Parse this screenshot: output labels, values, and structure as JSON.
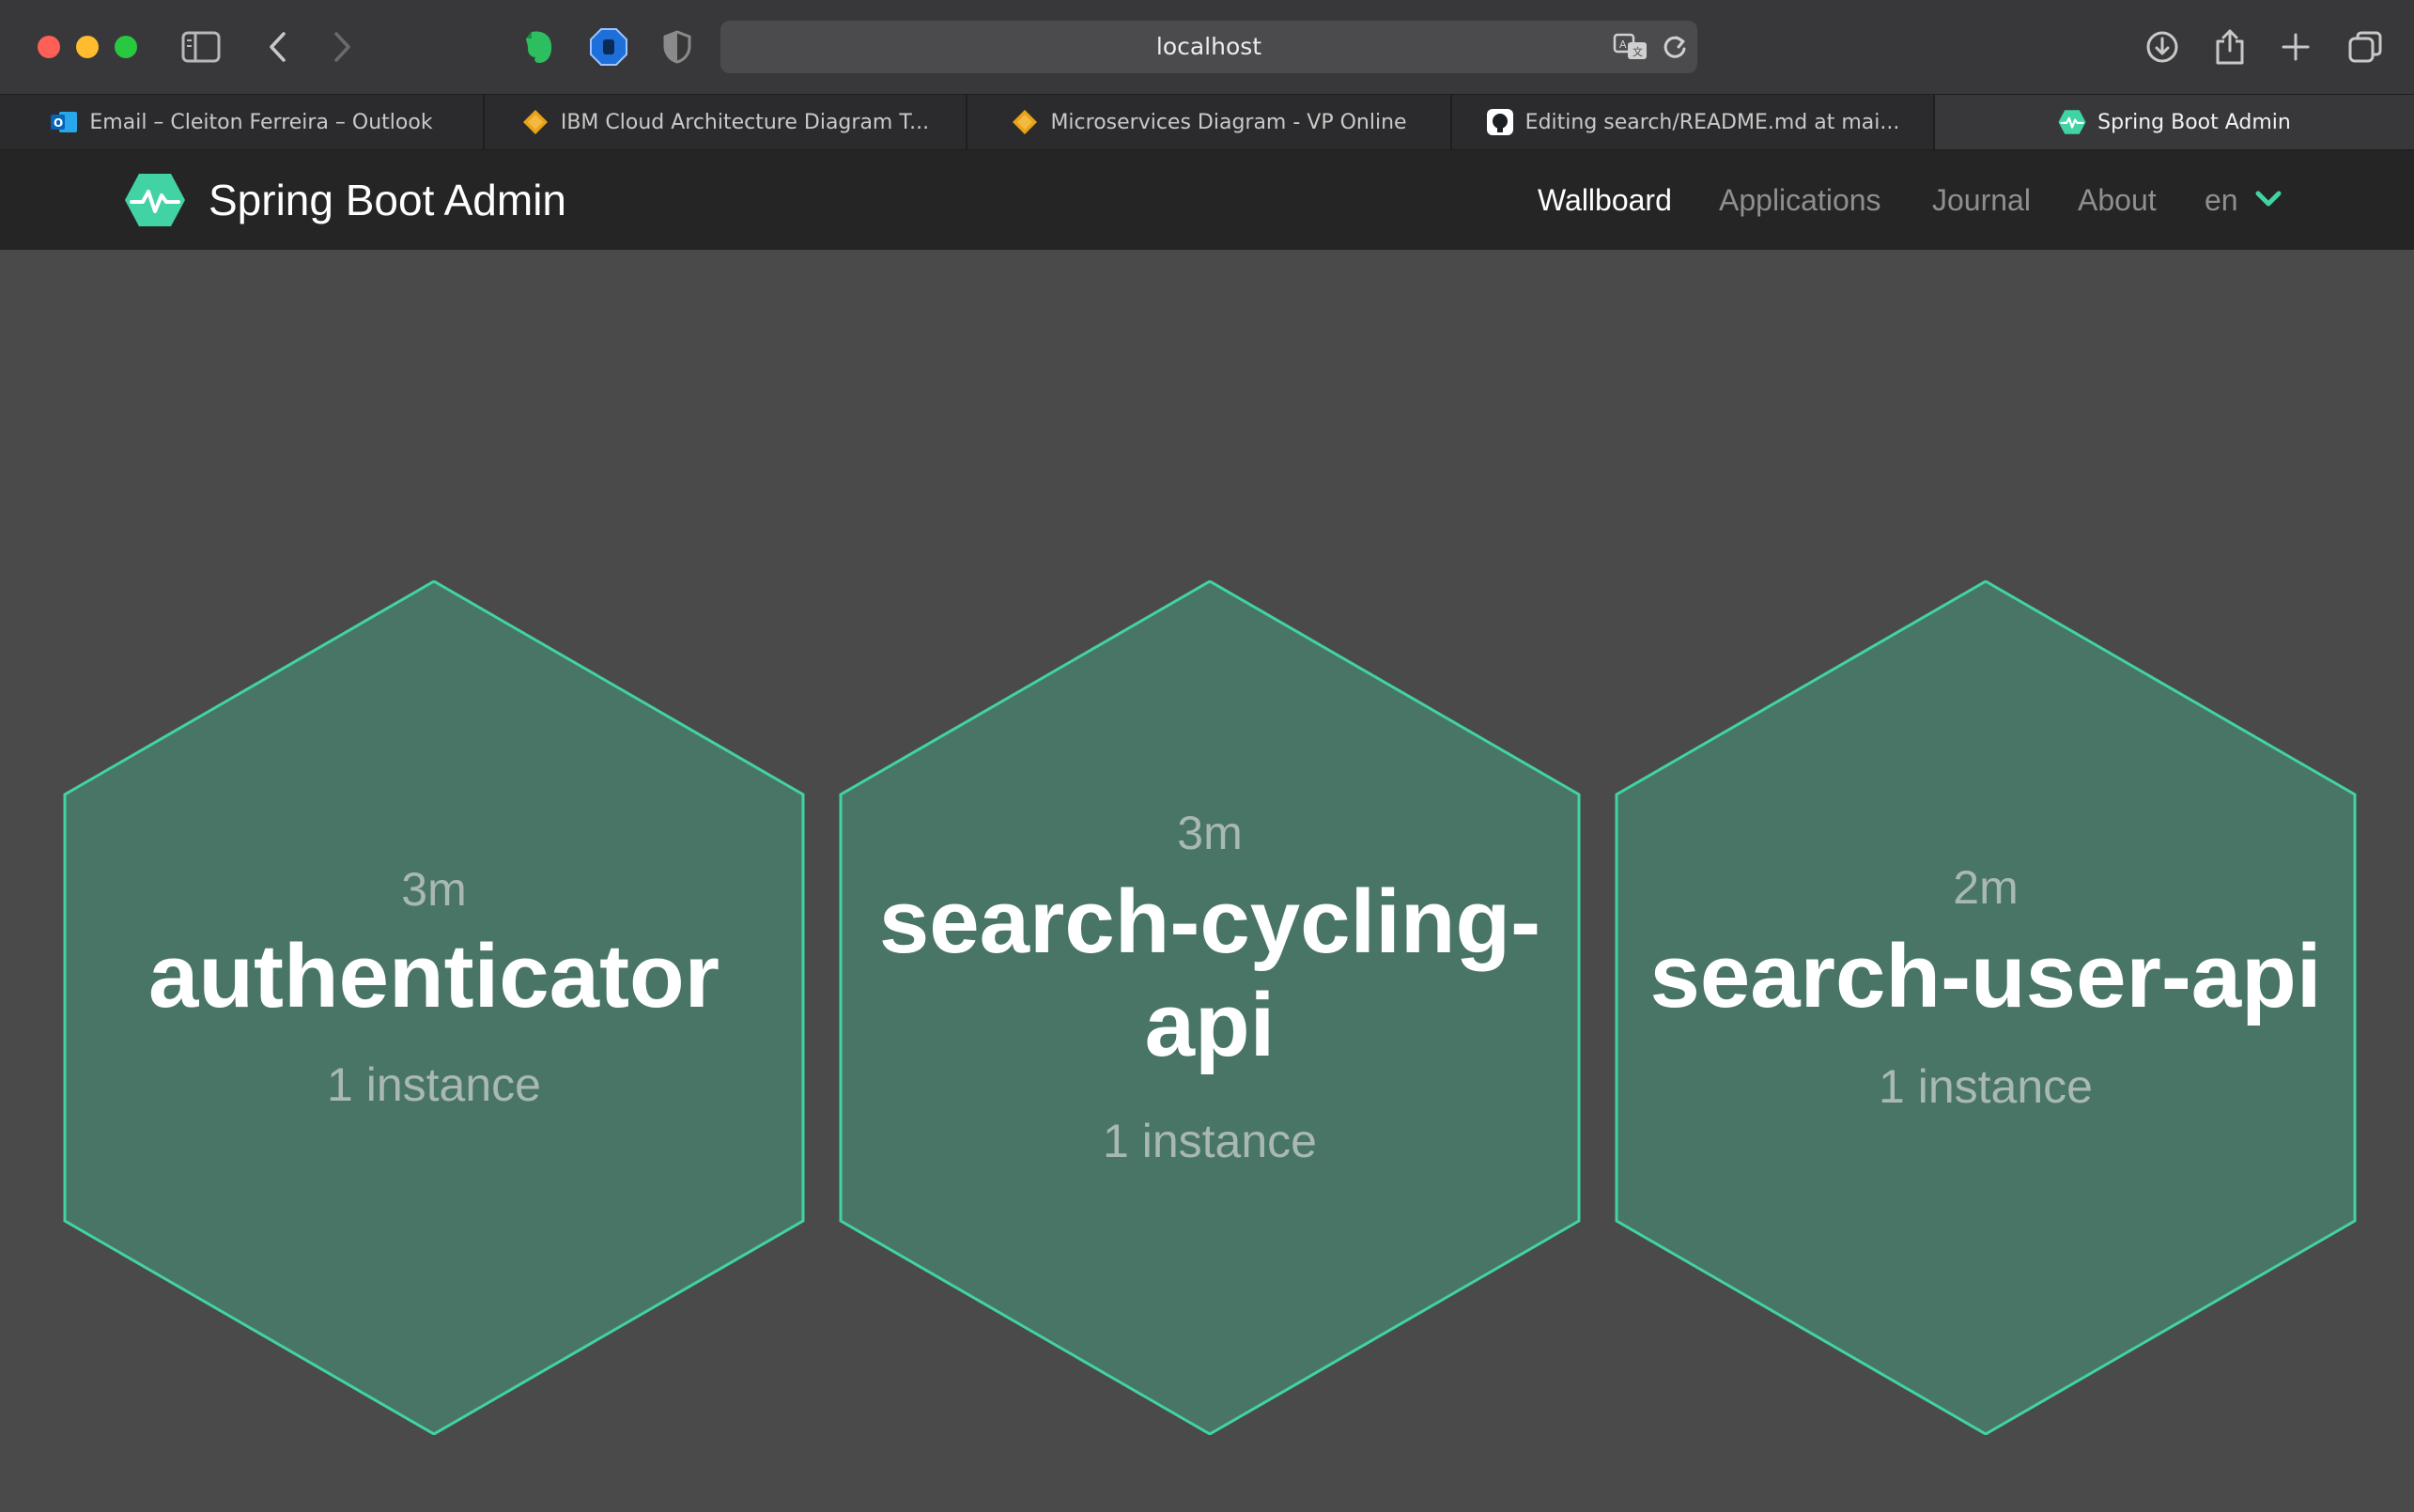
{
  "browser": {
    "url": "localhost",
    "tabs": [
      {
        "label": "Email – Cleiton Ferreira – Outlook",
        "icon": "outlook-icon"
      },
      {
        "label": "IBM Cloud Architecture Diagram T...",
        "icon": "diamond-icon"
      },
      {
        "label": "Microservices Diagram - VP Online",
        "icon": "diamond-icon"
      },
      {
        "label": "Editing search/README.md at mai...",
        "icon": "github-icon"
      },
      {
        "label": "Spring Boot Admin",
        "icon": "spring-boot-admin-icon",
        "active": true
      }
    ]
  },
  "navbar": {
    "title": "Spring Boot Admin",
    "items": [
      {
        "label": "Wallboard",
        "active": true
      },
      {
        "label": "Applications"
      },
      {
        "label": "Journal"
      },
      {
        "label": "About"
      }
    ],
    "language": "en"
  },
  "applications": [
    {
      "time": "3m",
      "name": "authenticator",
      "instances": "1 instance"
    },
    {
      "time": "3m",
      "name_lines": [
        "search-cycling-",
        "api"
      ],
      "instances": "1 instance"
    },
    {
      "time": "2m",
      "name": "search-user-api",
      "instances": "1 instance"
    }
  ],
  "colors": {
    "accent": "#42d3a5",
    "hex_fill": "#487565",
    "background": "#4a4a4a",
    "navbar": "#252525"
  }
}
